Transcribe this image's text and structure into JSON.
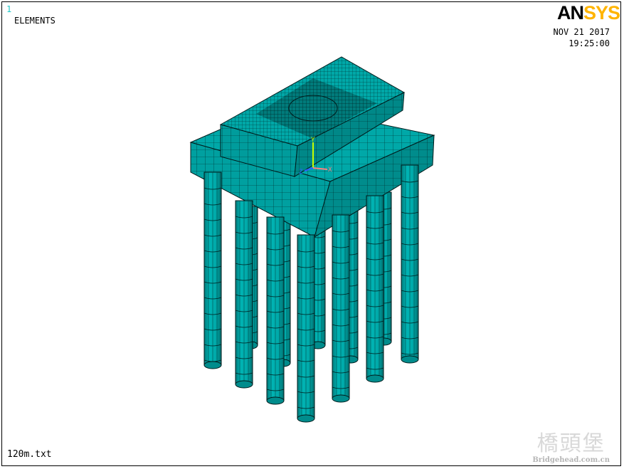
{
  "window": {
    "number": "1",
    "plot_label": "ELEMENTS"
  },
  "brand": {
    "logo_an": "AN",
    "logo_sys": "SYS"
  },
  "timestamp": {
    "date": "NOV 21 2017",
    "time": "19:25:00"
  },
  "file": {
    "name": "120m.txt"
  },
  "watermark": {
    "chinese": "橋頭堡",
    "url": "Bridgehead.com.cn"
  },
  "triad": {
    "y_label": "Y",
    "x_label": "X",
    "z_label": "Z"
  },
  "colors": {
    "element_fill": "#00a8a8",
    "element_light": "#40c8c8",
    "element_dark": "#007a7a",
    "mesh_line": "#001a1a",
    "triad_y": "#c8ff00",
    "triad_x": "#ff8080"
  },
  "model": {
    "description_icon": "pile-cap-foundation-mesh",
    "pile_count": 12
  }
}
